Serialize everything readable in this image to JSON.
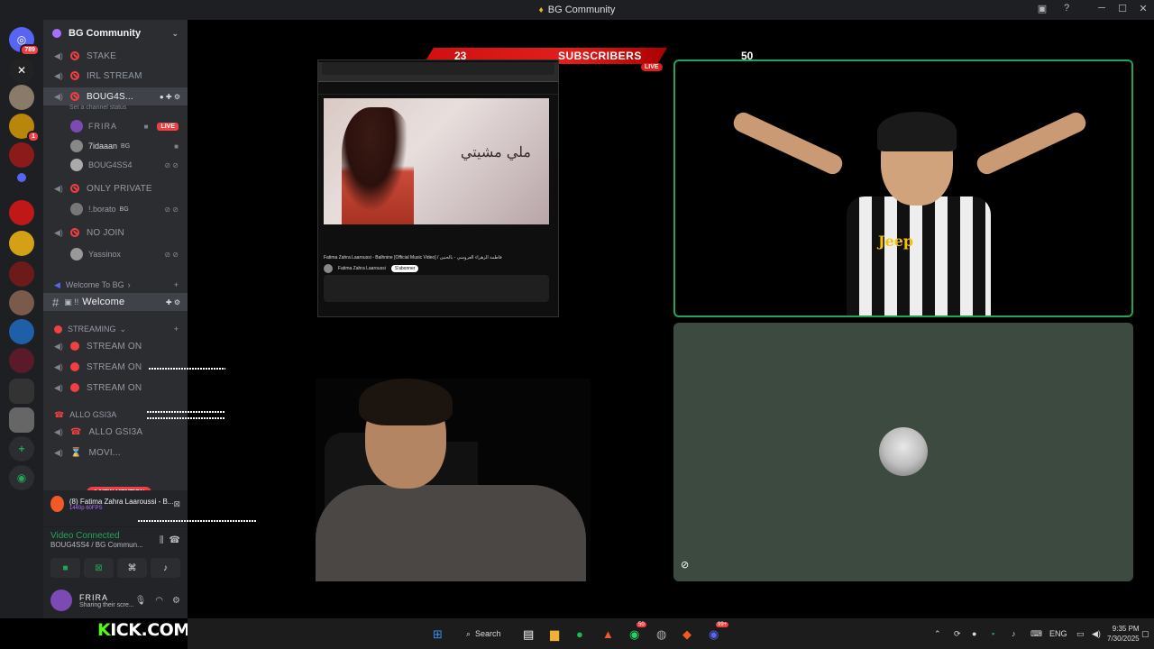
{
  "window": {
    "title": "BG Community",
    "controls": [
      "─",
      "☐",
      "✕"
    ]
  },
  "rail": {
    "top_badge": "789",
    "badges": [
      "1"
    ]
  },
  "sidebar": {
    "server_name": "BG Community",
    "channels": [
      {
        "name": "STAKE"
      },
      {
        "name": "IRL STREAM"
      },
      {
        "name": "BOUG4S..."
      },
      {
        "name": "ONLY PRIVATE"
      },
      {
        "name": "NO JOIN"
      }
    ],
    "status_hint": "Set a channel status",
    "voice_users": [
      {
        "name": "FRIRA",
        "live": "LIVE"
      },
      {
        "name": "7idaaan",
        "tag": "BG"
      },
      {
        "name": "BOUG4SS4"
      },
      {
        "name": "!.borato",
        "tag": "BG"
      },
      {
        "name": "Yassinox"
      }
    ],
    "welcome_category": "Welcome To BG",
    "welcome_channel": "Welcome",
    "welcome_prefix": "#",
    "streaming_category": "STREAMING",
    "stream_channels": [
      "STREAM ON",
      "STREAM ON",
      "STREAM ON"
    ],
    "allo_category": "ALLO GSI3A",
    "allo_channel": "ALLO GSI3A",
    "movie_channel": "MOVI...",
    "mention_pill": "1 NEW MENTION"
  },
  "media_panel": {
    "title": "(8) Fatima Zahra Laaroussi - B...",
    "quality": "1440p 60FPS"
  },
  "voice_panel": {
    "status": "Video Connected",
    "location": "BOUG4SS4 / BG Commun..."
  },
  "user_panel": {
    "name": "FRIRA",
    "status": "Sharing their scre..."
  },
  "stream_overlay": {
    "subs_current": "23",
    "subs_label": "SUBSCRIBERS",
    "subs_goal": "50",
    "live": "LIVE",
    "kick_prefix": "K",
    "kick_text": "ICK.COM/FRIRAA"
  },
  "screen_share": {
    "video_title": "Fatima Zahra Laaroussi - Balhnine [Official Music Video] / فاطمة الزهراء العروسي - بالحنين",
    "channel": "Fatima Zahra Laaroussi",
    "subscribe": "S'abonner",
    "arabic_caption": "ملي مشيتي"
  },
  "taskbar": {
    "search": "Search",
    "lang": "ENG",
    "time": "9:35 PM",
    "date": "7/30/2025",
    "whatsapp_badge": "50",
    "discord_badge": "99+"
  },
  "colors": {
    "accent_green": "#23a559",
    "danger": "#f23f43",
    "kick_green": "#53fc18"
  }
}
